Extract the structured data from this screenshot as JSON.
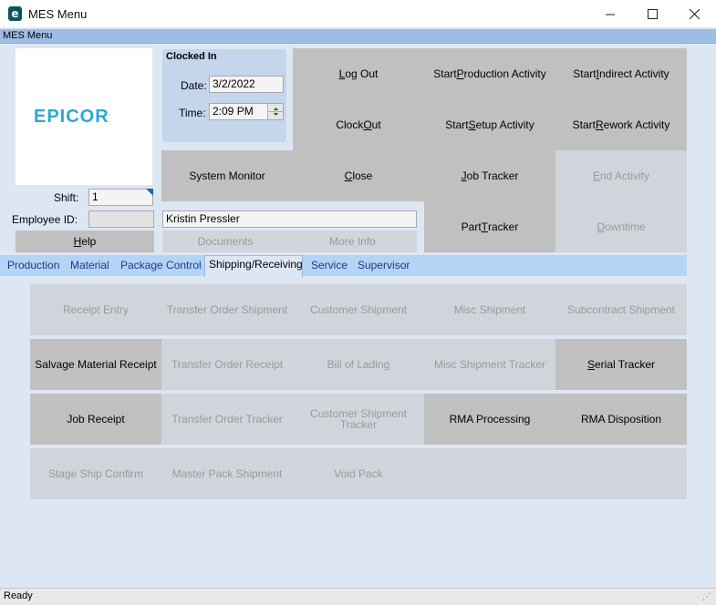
{
  "window": {
    "title": "MES Menu",
    "icon_letter": "e"
  },
  "menubar": {
    "label": "MES Menu"
  },
  "logo": {
    "text": "EPICOR",
    "mark": "."
  },
  "clock": {
    "heading": "Clocked In",
    "date_label": "Date:",
    "date_value": "3/2/2022",
    "time_label": "Time:",
    "time_value": "2:09 PM"
  },
  "employee": {
    "shift_label": "Shift:",
    "shift_value": "1",
    "id_label": "Employee ID:",
    "id_value": "",
    "name_value": "Kristin Pressler"
  },
  "actions": {
    "log_out": {
      "pre": "",
      "key": "L",
      "post": "og Out"
    },
    "clock_out": {
      "pre": "Clock ",
      "key": "O",
      "post": "ut"
    },
    "start_production": {
      "pre": "Start ",
      "key": "P",
      "post": "roduction Activity"
    },
    "start_indirect": {
      "pre": "Start ",
      "key": "I",
      "post": "ndirect Activity"
    },
    "start_setup": {
      "pre": "Start ",
      "key": "S",
      "post": "etup Activity"
    },
    "start_rework": {
      "pre": "Start ",
      "key": "R",
      "post": "ework Activity"
    },
    "system_monitor": "System Monitor",
    "close": {
      "pre": "",
      "key": "C",
      "post": "lose"
    },
    "job_tracker": {
      "pre": "",
      "key": "J",
      "post": "ob Tracker"
    },
    "end_activity": {
      "pre": "",
      "key": "E",
      "post": "nd Activity"
    },
    "part_tracker": {
      "pre": "Part ",
      "key": "T",
      "post": "racker"
    },
    "downtime": {
      "pre": "",
      "key": "D",
      "post": "owntime"
    },
    "help": {
      "pre": "",
      "key": "H",
      "post": "elp"
    },
    "documents": "Documents",
    "more_info": "More Info"
  },
  "tabs": [
    "Production",
    "Material",
    "Package Control",
    "Shipping/Receiving",
    "Service",
    "Supervisor"
  ],
  "shipping": {
    "receipt_entry": "Receipt Entry",
    "transfer_order_shipment": "Transfer Order Shipment",
    "customer_shipment": "Customer Shipment",
    "misc_shipment": "Misc Shipment",
    "subcontract_shipment": "Subcontract Shipment",
    "salvage_material_receipt": "Salvage Material Receipt",
    "transfer_order_receipt": "Transfer Order Receipt",
    "bill_of_lading": "Bill of Lading",
    "misc_shipment_tracker": "Misc Shipment Tracker",
    "serial_tracker": {
      "pre": "",
      "key": "S",
      "post": "erial Tracker"
    },
    "job_receipt": "Job Receipt",
    "transfer_order_tracker": "Transfer Order Tracker",
    "customer_shipment_tracker_1": "Customer Shipment",
    "customer_shipment_tracker_2": "Tracker",
    "rma_processing": "RMA Processing",
    "rma_disposition": "RMA Disposition",
    "stage_ship_confirm": "Stage Ship Confirm",
    "master_pack_shipment": "Master Pack Shipment",
    "void_pack": "Void Pack"
  },
  "status": {
    "text": "Ready"
  },
  "colors": {
    "tab_bar": "#b3d4f5",
    "logo": "#2aa8d8",
    "enabled_tile": "#c0c0c0",
    "disabled_tile": "#d0d4db"
  }
}
